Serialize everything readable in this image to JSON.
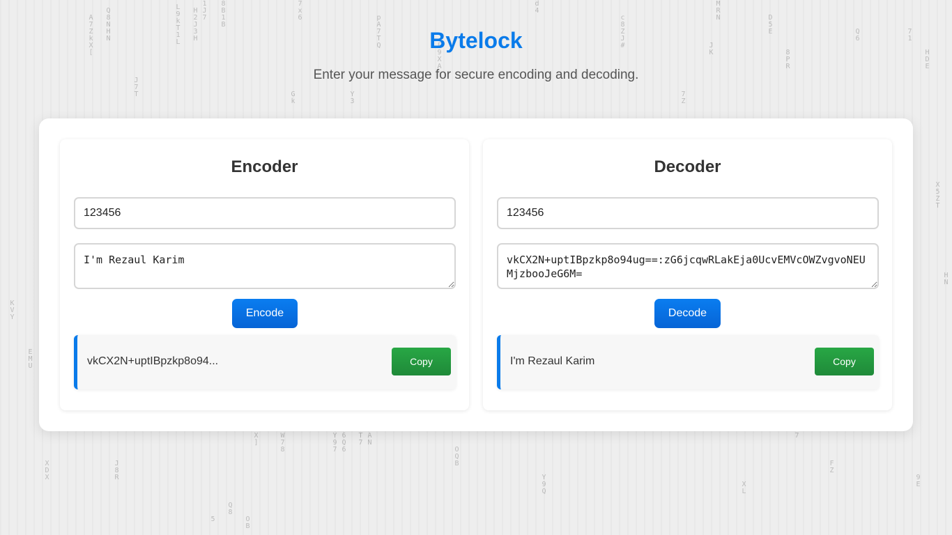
{
  "header": {
    "title": "Bytelock",
    "subtitle": "Enter your message for secure encoding and decoding."
  },
  "encoder": {
    "title": "Encoder",
    "key_value": "123456",
    "message_value": "I'm Rezaul Karim",
    "button_label": "Encode",
    "result_text": "vkCX2N+uptIBpzkp8o94...",
    "copy_label": "Copy"
  },
  "decoder": {
    "title": "Decoder",
    "key_value": "123456",
    "message_value": "vkCX2N+uptIBpzkp8o94ug==:zG6jcqwRLakEja0UcvEMVcOWZvgvoNEUMjzbooJeG6M=",
    "button_label": "Decode",
    "result_text": "I'm Rezaul Karim",
    "copy_label": "Copy"
  },
  "colors": {
    "accent": "#0a7bea",
    "copy_button": "#28a745"
  }
}
